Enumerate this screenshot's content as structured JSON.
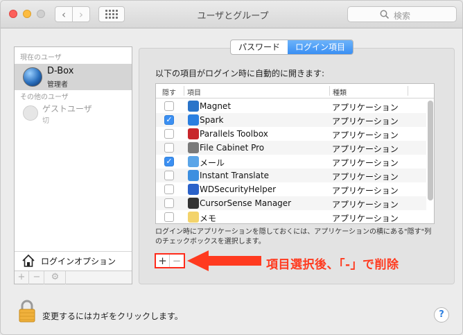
{
  "window": {
    "title": "ユーザとグループ"
  },
  "toolbar": {
    "search_placeholder": "検索"
  },
  "sidebar": {
    "current_label": "現在のユーザ",
    "current_user": {
      "name": "D-Box",
      "role": "管理者"
    },
    "other_label": "その他のユーザ",
    "guest": {
      "name": "ゲストユーザ",
      "status": "切"
    },
    "login_options_label": "ログインオプション",
    "toolbar": {
      "add": "+",
      "remove": "−"
    }
  },
  "tabs": [
    {
      "label": "パスワード",
      "active": false
    },
    {
      "label": "ログイン項目",
      "active": true
    }
  ],
  "main": {
    "intro": "以下の項目がログイン時に自動的に開きます:",
    "columns": {
      "hide": "隠す",
      "item": "項目",
      "kind": "種類"
    },
    "items": [
      {
        "name": "Magnet",
        "kind": "アプリケーション",
        "hidden": false,
        "icon": "magnet-icon",
        "color": "#2a74c9"
      },
      {
        "name": "Spark",
        "kind": "アプリケーション",
        "hidden": true,
        "icon": "spark-icon",
        "color": "#2a7fe0"
      },
      {
        "name": "Parallels Toolbox",
        "kind": "アプリケーション",
        "hidden": false,
        "icon": "parallels-toolbox-icon",
        "color": "#c8262b"
      },
      {
        "name": "File Cabinet Pro",
        "kind": "アプリケーション",
        "hidden": false,
        "icon": "file-cabinet-icon",
        "color": "#7a7a7a"
      },
      {
        "name": "メール",
        "kind": "アプリケーション",
        "hidden": true,
        "icon": "mail-icon",
        "color": "#5aa5e8"
      },
      {
        "name": "Instant Translate",
        "kind": "アプリケーション",
        "hidden": false,
        "icon": "instant-translate-icon",
        "color": "#3d8fe0"
      },
      {
        "name": "WDSecurityHelper",
        "kind": "アプリケーション",
        "hidden": false,
        "icon": "wd-security-icon",
        "color": "#2b62c9"
      },
      {
        "name": "CursorSense Manager",
        "kind": "アプリケーション",
        "hidden": false,
        "icon": "cursorsense-icon",
        "color": "#333333"
      },
      {
        "name": "メモ",
        "kind": "アプリケーション",
        "hidden": false,
        "icon": "notes-icon",
        "color": "#f3d36b"
      }
    ],
    "note": "ログイン時にアプリケーションを隠しておくには、アプリケーションの横にある\"隠す\"列のチェックボックスを選択します。",
    "add_label": "+",
    "remove_label": "−",
    "annotation": "項目選択後、「-」で削除"
  },
  "footer": {
    "lock_text": "変更するにはカギをクリックします。",
    "help_label": "?"
  },
  "colors": {
    "accent": "#3b8ff2",
    "annotation": "#ff3a1f"
  }
}
